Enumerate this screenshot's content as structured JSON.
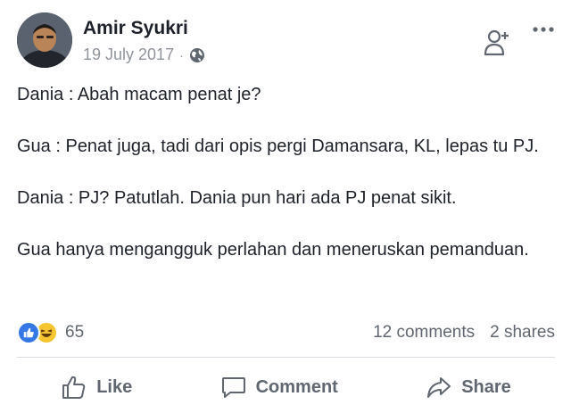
{
  "post": {
    "author_name": "Amir Syukri",
    "date": "19 July 2017",
    "separator": "·",
    "privacy_icon": "globe-icon",
    "paragraphs": [
      "Dania : Abah macam penat je?",
      "Gua : Penat juga, tadi dari opis pergi Damansara, KL, lepas tu PJ.",
      "Dania : PJ? Patutlah. Dania pun hari ada PJ penat sikit.",
      "Gua hanya mengangguk perlahan dan meneruskan pemanduan."
    ]
  },
  "stats": {
    "reaction_icons": [
      "like-reaction-icon",
      "haha-reaction-icon"
    ],
    "reaction_count": "65",
    "comments": "12 comments",
    "shares": "2 shares"
  },
  "actions": {
    "like": "Like",
    "comment": "Comment",
    "share": "Share"
  },
  "colors": {
    "text": "#1d2129",
    "muted": "#606770",
    "meta": "#90949c",
    "like_blue": "#3578e5",
    "haha_yellow": "#f7c531",
    "divider": "#dadde1"
  }
}
